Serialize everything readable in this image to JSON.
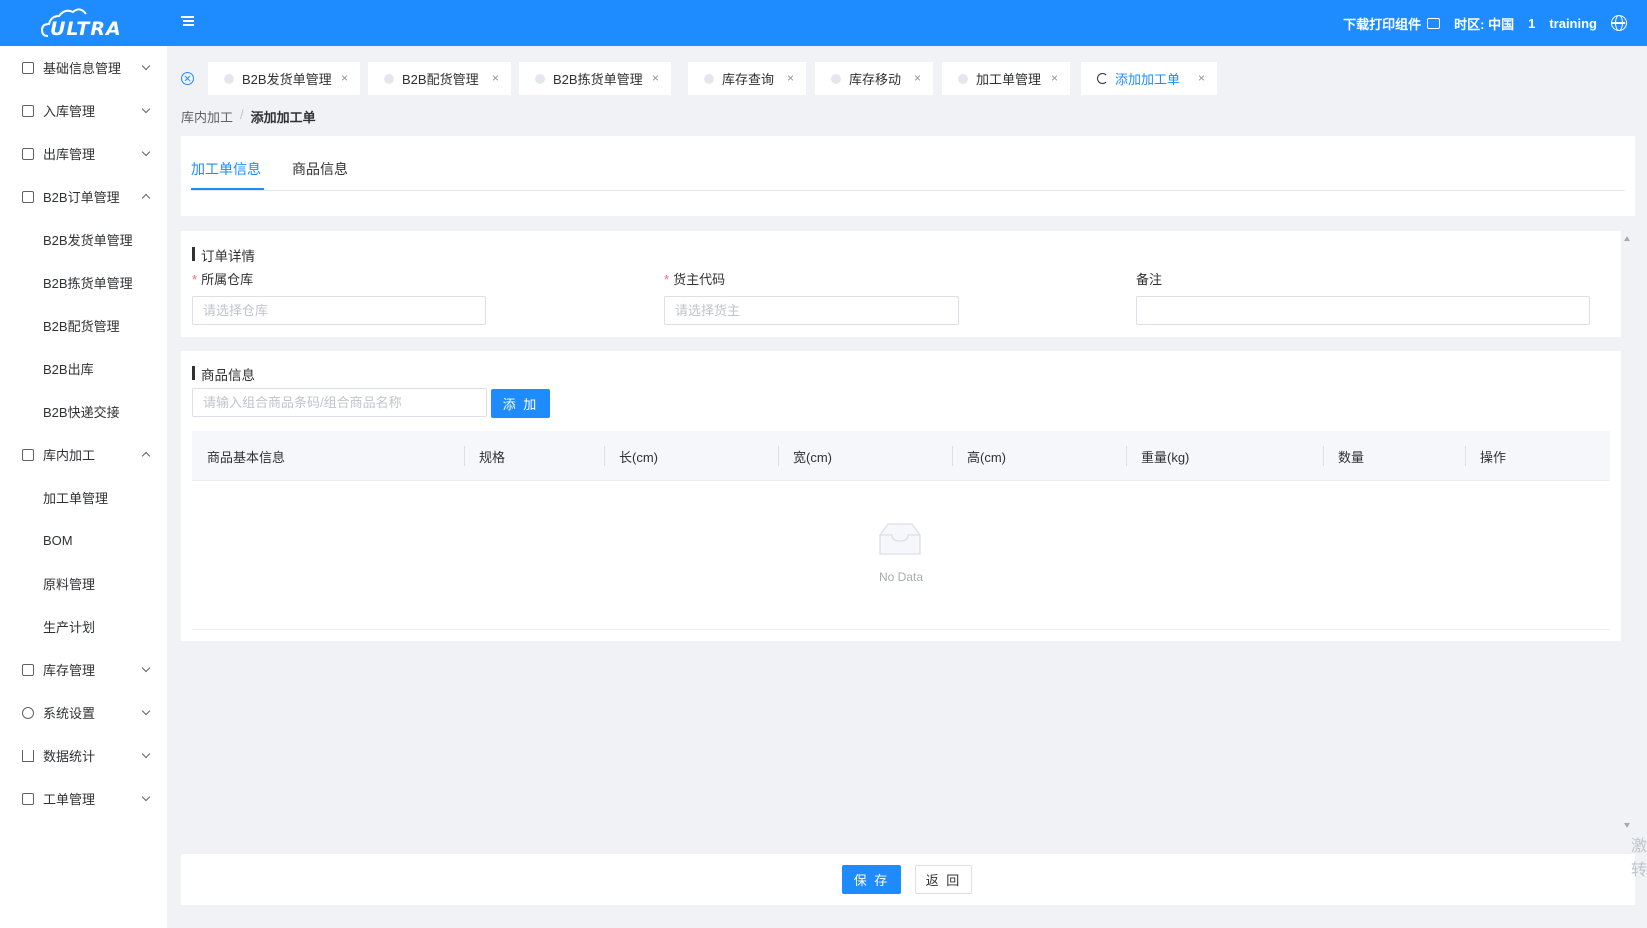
{
  "header": {
    "logo_text": "ULTRA",
    "download_label": "下载打印组件",
    "timezone_label": "时区: 中国",
    "user_id": "1",
    "username": "training"
  },
  "sidebar": {
    "items": [
      {
        "label": "基础信息管理"
      },
      {
        "label": "入库管理"
      },
      {
        "label": "出库管理"
      },
      {
        "label": "B2B订单管理"
      },
      {
        "label": "库内加工"
      },
      {
        "label": "库存管理"
      },
      {
        "label": "系统设置"
      },
      {
        "label": "数据统计"
      },
      {
        "label": "工单管理"
      }
    ],
    "b2b_sub": [
      "B2B发货单管理",
      "B2B拣货单管理",
      "B2B配货管理",
      "B2B出库",
      "B2B快递交接"
    ],
    "process_sub": [
      "加工单管理",
      "BOM",
      "原料管理",
      "生产计划"
    ]
  },
  "tabs": [
    {
      "label": "B2B发货单管理"
    },
    {
      "label": "B2B配货管理"
    },
    {
      "label": "B2B拣货单管理"
    },
    {
      "label": "库存查询"
    },
    {
      "label": "库存移动"
    },
    {
      "label": "加工单管理"
    },
    {
      "label": "添加加工单"
    }
  ],
  "breadcrumb": {
    "parent": "库内加工",
    "current": "添加加工单"
  },
  "inner_tabs": [
    "加工单信息",
    "商品信息"
  ],
  "order_section": {
    "title": "订单详情",
    "warehouse_label": "所属仓库",
    "warehouse_placeholder": "请选择仓库",
    "owner_label": "货主代码",
    "owner_placeholder": "请选择货主",
    "remark_label": "备注",
    "required_mark": "*"
  },
  "goods_section": {
    "title": "商品信息",
    "search_placeholder": "请输入组合商品条码/组合商品名称",
    "add_label": "添 加",
    "columns": [
      "商品基本信息",
      "规格",
      "长(cm)",
      "宽(cm)",
      "高(cm)",
      "重量(kg)",
      "数量",
      "操作"
    ],
    "empty_text": "No Data"
  },
  "footer": {
    "save_label": "保 存",
    "back_label": "返 回"
  },
  "watermark": {
    "line1": "激",
    "line2": "转"
  },
  "colors": {
    "primary": "#1e8cff",
    "required": "#f56c6c"
  }
}
